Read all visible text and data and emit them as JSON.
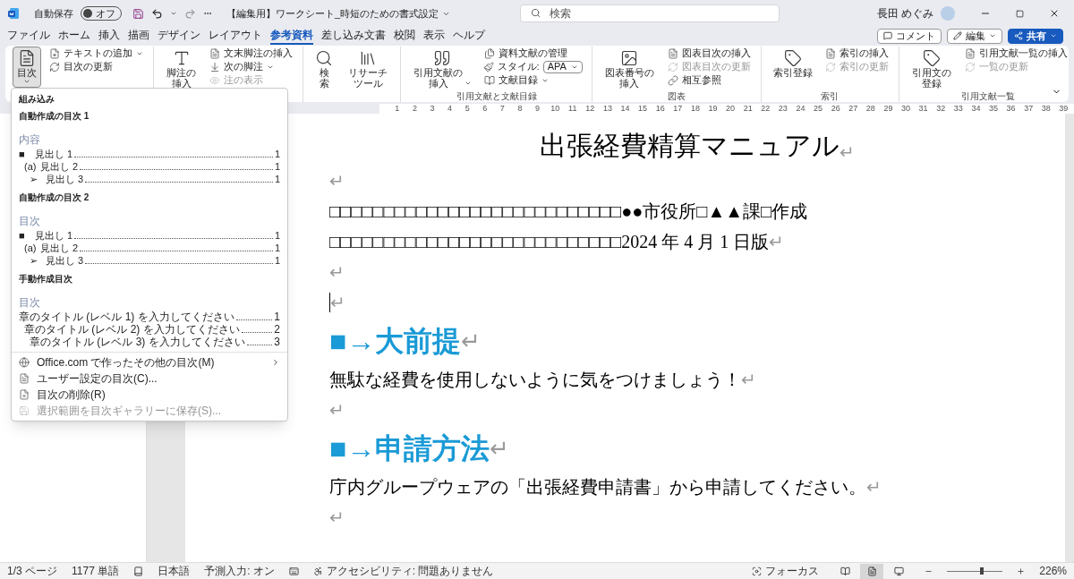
{
  "title_bar": {
    "autosave_label": "自動保存",
    "autosave": {
      "on": false,
      "label": "オフ"
    },
    "document_title": "【編集用】ワークシート_時短のための書式設定",
    "search": {
      "placeholder": "検索"
    },
    "user_name": "長田 めぐみ"
  },
  "actions": [
    {
      "kind": "comment",
      "label": "コメント"
    },
    {
      "kind": "edit",
      "label": "編集"
    },
    {
      "kind": "share",
      "label": "共有"
    }
  ],
  "tabs": [
    {
      "label": "ファイル",
      "selected": false
    },
    {
      "label": "ホーム",
      "selected": false
    },
    {
      "label": "挿入",
      "selected": false
    },
    {
      "label": "描画",
      "selected": false
    },
    {
      "label": "デザイン",
      "selected": false
    },
    {
      "label": "レイアウト",
      "selected": false
    },
    {
      "label": "参考資料",
      "selected": true
    },
    {
      "label": "差し込み文書",
      "selected": false
    },
    {
      "label": "校閲",
      "selected": false
    },
    {
      "label": "表示",
      "selected": false
    },
    {
      "label": "ヘルプ",
      "selected": false
    }
  ],
  "ribbon": {
    "groups": [
      {
        "items": [
          {
            "kind": "large",
            "label": "目次",
            "dropdown": true,
            "expanded": true,
            "disabled": false
          },
          {
            "kind": "small",
            "label": "テキストの追加",
            "dropdown": true,
            "expanded": false,
            "disabled": false
          },
          {
            "kind": "small",
            "label": "目次の更新",
            "dropdown": false,
            "expanded": false,
            "disabled": false
          }
        ]
      },
      {
        "items": [
          {
            "kind": "large",
            "label": "脚注の挿入",
            "dropdown": false,
            "expanded": false,
            "disabled": false
          },
          {
            "kind": "small",
            "label": "文末脚注の挿入",
            "dropdown": false,
            "expanded": false,
            "disabled": false
          },
          {
            "kind": "small",
            "label": "次の脚注",
            "dropdown": true,
            "expanded": false,
            "disabled": false
          },
          {
            "kind": "small",
            "label": "注の表示",
            "dropdown": false,
            "expanded": false,
            "disabled": true
          }
        ]
      },
      {
        "items": [
          {
            "kind": "large",
            "label": "検索",
            "dropdown": false,
            "expanded": false,
            "disabled": false
          },
          {
            "kind": "large",
            "label": "リサーチツール",
            "dropdown": false,
            "expanded": false,
            "disabled": false
          }
        ]
      },
      {
        "label": "引用文献と文献目録",
        "items": [
          {
            "kind": "large",
            "label": "引用文献の挿入",
            "dropdown": true,
            "expanded": false,
            "disabled": false
          },
          {
            "kind": "small",
            "label": "資料文献の管理",
            "dropdown": false,
            "expanded": false,
            "disabled": false
          },
          {
            "kind": "select",
            "label": "スタイル:",
            "value": "APA",
            "dropdown": true,
            "expanded": false,
            "disabled": false
          },
          {
            "kind": "small",
            "label": "文献目録",
            "dropdown": true,
            "expanded": false,
            "disabled": false
          }
        ]
      },
      {
        "label": "図表",
        "items": [
          {
            "kind": "large",
            "label": "図表番号の挿入",
            "dropdown": false,
            "expanded": false,
            "disabled": false
          },
          {
            "kind": "small",
            "label": "図表目次の挿入",
            "dropdown": false,
            "expanded": false,
            "disabled": false
          },
          {
            "kind": "small",
            "label": "図表目次の更新",
            "dropdown": false,
            "expanded": false,
            "disabled": true
          },
          {
            "kind": "small",
            "label": "相互参照",
            "dropdown": false,
            "expanded": false,
            "disabled": false
          }
        ]
      },
      {
        "label": "索引",
        "items": [
          {
            "kind": "large",
            "label": "索引登録",
            "dropdown": false,
            "expanded": false,
            "disabled": false
          },
          {
            "kind": "small",
            "label": "索引の挿入",
            "dropdown": false,
            "expanded": false,
            "disabled": false
          },
          {
            "kind": "small",
            "label": "索引の更新",
            "dropdown": false,
            "expanded": false,
            "disabled": true
          }
        ]
      },
      {
        "label": "引用文献一覧",
        "items": [
          {
            "kind": "large",
            "label": "引用文の登録",
            "dropdown": false,
            "expanded": false,
            "disabled": false
          },
          {
            "kind": "small",
            "label": "引用文献一覧の挿入",
            "dropdown": false,
            "expanded": false,
            "disabled": false
          },
          {
            "kind": "small",
            "label": "一覧の更新",
            "dropdown": false,
            "expanded": false,
            "disabled": true
          }
        ]
      }
    ]
  },
  "ruler_numbers": [
    "1",
    "2",
    "3",
    "4",
    "5",
    "6",
    "7",
    "8",
    "9",
    "10",
    "11",
    "12",
    "13",
    "14",
    "15",
    "16",
    "17",
    "18",
    "19",
    "20",
    "21",
    "22",
    "23",
    "24",
    "25",
    "26",
    "27",
    "28",
    "29",
    "30",
    "31",
    "32",
    "33",
    "34",
    "35",
    "36",
    "37",
    "38",
    "39"
  ],
  "toc_menu": {
    "section_title": "組み込み",
    "gallery": [
      {
        "title": "自動作成の目次 1",
        "heading": "内容",
        "lines": [
          {
            "marker": "■",
            "text": "見出し 1",
            "page": "1"
          },
          {
            "marker": "(a)",
            "text": "見出し 2",
            "page": "1"
          },
          {
            "marker": "➢",
            "text": "見出し 3",
            "page": "1"
          }
        ]
      },
      {
        "title": "自動作成の目次 2",
        "heading": "目次",
        "lines": [
          {
            "marker": "■",
            "text": "見出し 1",
            "page": "1"
          },
          {
            "marker": "(a)",
            "text": "見出し 2",
            "page": "1"
          },
          {
            "marker": "➢",
            "text": "見出し 3",
            "page": "1"
          }
        ]
      },
      {
        "title": "手動作成目次",
        "heading": "目次",
        "lines": [
          {
            "text": "章のタイトル (レベル 1) を入力してください",
            "page": "1"
          },
          {
            "text": "章のタイトル (レベル 2) を入力してください",
            "page": "2"
          },
          {
            "text": "章のタイトル (レベル 3) を入力してください",
            "page": "3"
          }
        ]
      }
    ],
    "items": [
      {
        "label": "Office.com で作ったその他の目次(M)",
        "submenu": true,
        "disabled": false
      },
      {
        "label": "ユーザー設定の目次(C)...",
        "submenu": false,
        "disabled": false
      },
      {
        "label": "目次の削除(R)",
        "submenu": false,
        "disabled": false
      },
      {
        "label": "選択範囲を目次ギャラリーに保存(S)...",
        "submenu": false,
        "disabled": true
      }
    ]
  },
  "document": {
    "paragraphs": [
      {
        "kind": "title",
        "text": "出張経費精算マニュアル",
        "mark": "↵"
      },
      {
        "kind": "blank",
        "mark": "↵"
      },
      {
        "kind": "body",
        "text": "□□□□□□□□□□□□□□□□□□□□□□□□□□□●●市役所□▲▲課□作成"
      },
      {
        "kind": "body",
        "text": "□□□□□□□□□□□□□□□□□□□□□□□□□□□2024 年 4 月 1 日版",
        "mark": "↵"
      },
      {
        "kind": "blank",
        "mark": "↵"
      },
      {
        "kind": "cursor",
        "mark": "↵"
      },
      {
        "kind": "heading",
        "text": "■→大前提",
        "mark": "↵"
      },
      {
        "kind": "body",
        "text": "無駄な経費を使用しないように気をつけましょう！",
        "mark": "↵"
      },
      {
        "kind": "blank",
        "mark": "↵"
      },
      {
        "kind": "heading",
        "text": "■→申請方法",
        "mark": "↵"
      },
      {
        "kind": "body",
        "text": "庁内グループウェアの「出張経費申請書」から申請してください。",
        "mark": "↵"
      },
      {
        "kind": "blank",
        "mark": "↵"
      }
    ]
  },
  "status_bar": {
    "left": [
      "1/3 ページ",
      "1177 単語",
      "日本語",
      "予測入力: オン",
      "アクセシビリティ: 問題ありません"
    ],
    "focus": "フォーカス",
    "views": [
      {
        "kind": "read",
        "selected": false
      },
      {
        "kind": "print",
        "selected": true
      },
      {
        "kind": "web",
        "selected": false
      }
    ],
    "zoom": {
      "level": 0.63,
      "reading": "226%"
    }
  }
}
